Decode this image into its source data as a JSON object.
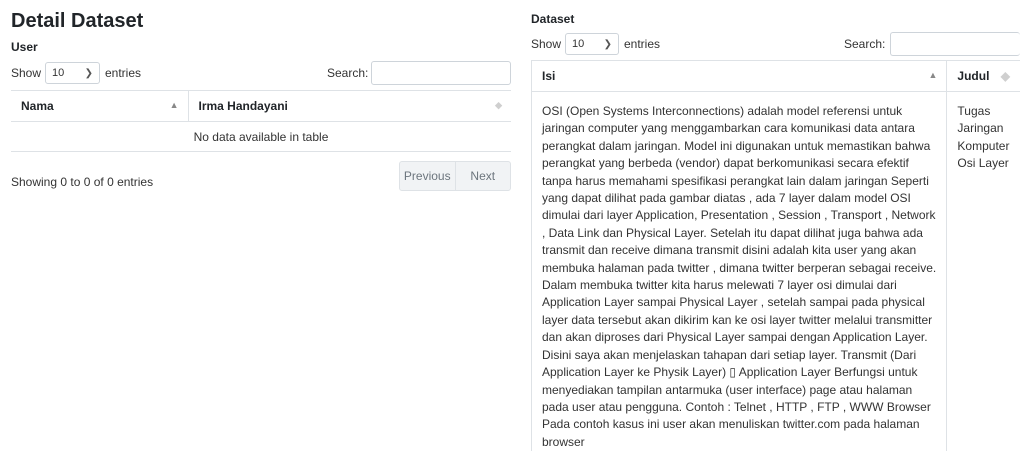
{
  "page": {
    "title": "Detail Dataset"
  },
  "user_section": {
    "label": "User",
    "show_label": "Show",
    "entries_value": "10",
    "entries_label": "entries",
    "search_label": "Search:",
    "search_value": "",
    "columns": [
      "Nama",
      "Irma Handayani"
    ],
    "empty_message": "No data available in table",
    "info": "Showing 0 to 0 of 0 entries",
    "pagination": {
      "previous": "Previous",
      "next": "Next"
    }
  },
  "dataset_section": {
    "label": "Dataset",
    "show_label": "Show",
    "entries_value": "10",
    "entries_label": "entries",
    "search_label": "Search:",
    "search_value": "",
    "columns": [
      "Isi",
      "Judul"
    ],
    "rows": [
      {
        "isi": "OSI (Open Systems Interconnections) adalah model referensi untuk jaringan computer yang menggambarkan cara komunikasi data antara perangkat dalam jaringan. Model ini digunakan untuk memastikan bahwa perangkat yang berbeda (vendor) dapat berkomunikasi secara efektif tanpa harus memahami spesifikasi perangkat lain dalam jaringan Seperti yang dapat dilihat pada gambar diatas , ada 7 layer dalam model OSI dimulai dari layer Application, Presentation , Session , Transport , Network , Data Link dan Physical Layer. Setelah itu dapat dilihat juga bahwa ada transmit dan receive dimana transmit disini adalah kita user yang akan membuka halaman pada twitter , dimana twitter berperan sebagai receive. Dalam membuka twitter kita harus melewati 7 layer osi dimulai dari Application Layer sampai Physical Layer , setelah sampai pada physical layer data tersebut akan dikirim kan ke osi layer twitter melalui transmitter dan akan diproses dari Physical Layer sampai dengan Application Layer. Disini saya akan menjelaskan tahapan dari setiap layer. Transmit (Dari Application Layer ke Physik Layer) ▯ Application Layer Berfungsi untuk menyediakan tampilan antarmuka (user interface) page atau halaman pada user atau pengguna. Contoh : Telnet , HTTP , FTP , WWW Browser Pada contoh kasus ini user akan menuliskan twitter.com pada halaman browser",
        "judul": [
          "Tugas",
          "Jaringan",
          "Komputer",
          "Osi Layer"
        ]
      }
    ]
  }
}
